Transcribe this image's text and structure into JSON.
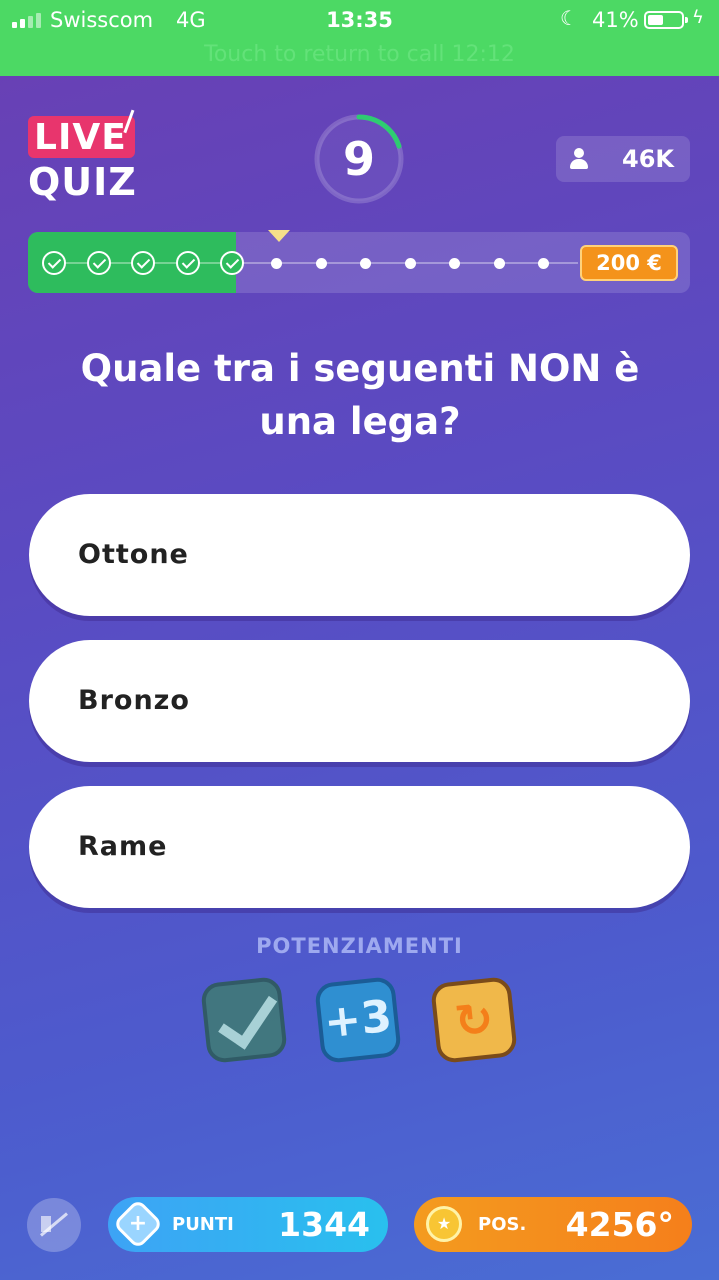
{
  "status_bar": {
    "carrier": "Swisscom",
    "network": "4G",
    "time": "13:35",
    "battery": "41%",
    "call_banner": "Touch to return to call 12:12"
  },
  "logo": {
    "line1": "LIVE",
    "line2": "QUIZ"
  },
  "timer": {
    "seconds": "9",
    "remaining_fraction": 0.2
  },
  "viewers": {
    "count": "46K"
  },
  "progress": {
    "answered": 5,
    "total": 12,
    "prize": "200 €"
  },
  "question": "Quale tra i seguenti NON è una lega?",
  "answers": [
    {
      "label": "Ottone"
    },
    {
      "label": "Bronzo"
    },
    {
      "label": "Rame"
    }
  ],
  "boosters": {
    "title": "POTENZIAMENTI",
    "plus3_label": "+3"
  },
  "bottom": {
    "points_label": "PUNTI",
    "points_value": "1344",
    "position_label": "POS.",
    "position_value": "4256°"
  },
  "colors": {
    "status_green": "#4cd964",
    "live_pink": "#e8356d",
    "done_green": "#2ebc5d",
    "prize_orange": "#f4931b"
  }
}
